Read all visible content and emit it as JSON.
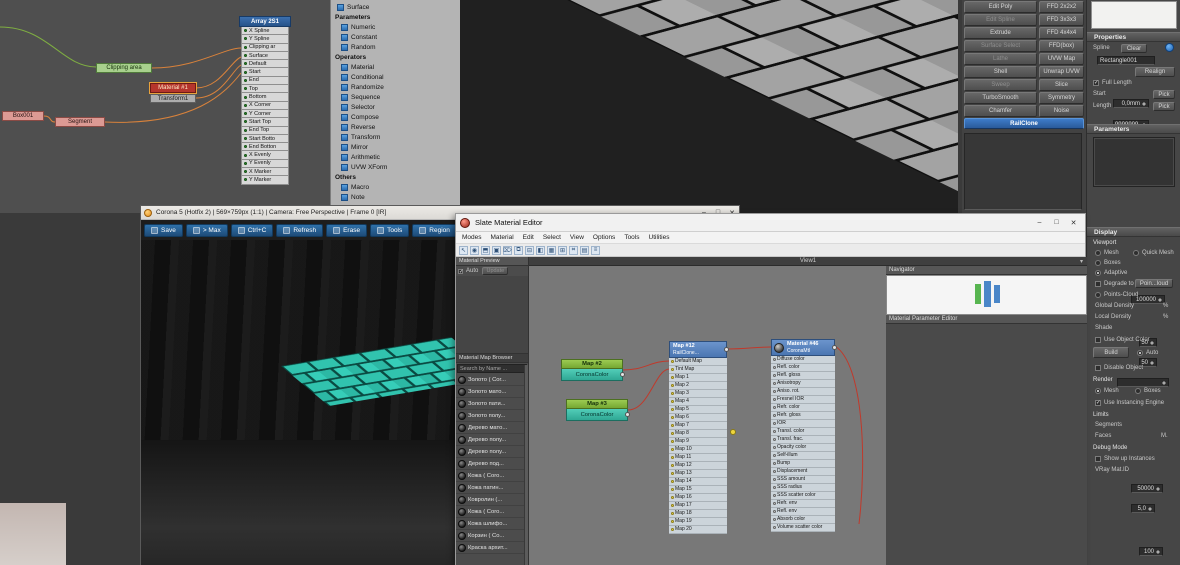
{
  "style_editor": {
    "array_node": {
      "title": "Array 2S1",
      "outputs": [
        "X Spline",
        "Y Spline",
        "Clipping ar",
        "Surface",
        "Default",
        "Start",
        "End",
        "Top",
        "Bottom",
        "X Corner",
        "Y Corner",
        "Start Top",
        "End Top",
        "Start Botto",
        "End Botton",
        "X Evenly",
        "Y Evenly",
        "X Marker",
        "Y Marker"
      ]
    },
    "clipping_node": "Clipping area",
    "material_node": "Material #1",
    "transform_node": "Transform1",
    "box_node": "Box001",
    "segment_node": "Segment",
    "palette": {
      "surface": "Surface",
      "groups": [
        {
          "label": "Parameters",
          "items": [
            "Numeric",
            "Constant",
            "Random"
          ]
        },
        {
          "label": "Operators",
          "items": [
            "Material",
            "Conditional",
            "Randomize",
            "Sequence",
            "Selector",
            "Compose",
            "Reverse",
            "Transform",
            "Mirror",
            "Arithmetic",
            "UVW XForm"
          ]
        },
        {
          "label": "Others",
          "items": [
            "Macro",
            "Note"
          ]
        }
      ]
    }
  },
  "modifier_panel": {
    "rows": [
      {
        "l": "Edit Poly",
        "r": "FFD 2x2x2"
      },
      {
        "l": "Edit Spline",
        "r": "FFD 3x3x3",
        "lcls": "dim"
      },
      {
        "l": "Extrude",
        "r": "FFD 4x4x4"
      },
      {
        "l": "Surface Select",
        "r": "FFD(box)",
        "lcls": "dim"
      },
      {
        "l": "Lathe",
        "r": "UVW Map",
        "lcls": "dim"
      },
      {
        "l": "Shell",
        "r": "Unwrap UVW"
      },
      {
        "l": "Sweep",
        "r": "Slice",
        "lcls": "dim"
      },
      {
        "l": "TurboSmooth",
        "r": "Symmetry"
      },
      {
        "l": "Chamfer",
        "r": "Noise"
      }
    ],
    "railclone": "RailClone"
  },
  "properties": {
    "title": "Properties",
    "spline": "Spline",
    "clear": "Clear",
    "spline_name": "Rectangle001",
    "realign": "Realign",
    "full_length": "Full Length",
    "start": "Start",
    "start_value": "0,0mm",
    "length": "Length",
    "length_value": "9999999,",
    "pick": "Pick",
    "parameters": "Parameters"
  },
  "display": {
    "title": "Display",
    "viewport": "Viewport",
    "mesh": "Mesh",
    "quick_mesh": "Quick Mesh",
    "boxes": "Boxes",
    "adaptive": "Adaptive",
    "adaptive_value": "100000",
    "degrade_to": "Degrade to",
    "degrade_btn": "Poin...loud",
    "points_cloud": "Points-Cloud",
    "global_density": "Global Density",
    "global_value": "50",
    "local_density": "Local Density",
    "local_value": "50",
    "percent": "%",
    "shade": "Shade",
    "use_object_color": "Use Object Color",
    "build": "Build",
    "auto": "Auto",
    "disable_object": "Disable Object",
    "render": "Render",
    "render_mesh": "Mesh",
    "render_boxes": "Boxes",
    "use_instancing": "Use Instancing Engine",
    "limits": "Limits",
    "segments": "Segments",
    "segments_value": "50000",
    "faces": "Faces",
    "faces_value": "5,0",
    "faces_unit": "M.",
    "debug": "Debug Mode",
    "show_instances": "Show up Instances",
    "vray": "VRay Mat.ID",
    "vray_value": "100"
  },
  "corona": {
    "title": "Corona 5 (Hotfix 2) | 569×759px (1:1) | Camera: Free Perspective | Frame 0 [IR]",
    "buttons": [
      "Save",
      "> Max",
      "Ctrl+C",
      "Refresh",
      "Erase",
      "Tools",
      "Region"
    ],
    "window_controls": {
      "min": "–",
      "max": "□",
      "close": "✕"
    }
  },
  "slate": {
    "title": "Slate Material Editor",
    "menus": [
      "Modes",
      "Material",
      "Edit",
      "Select",
      "View",
      "Options",
      "Tools",
      "Utilities"
    ],
    "toolbar_icons": [
      "↖",
      "◉",
      "⬒",
      "▣",
      "⌦",
      "⧉",
      "⊟",
      "◧",
      "▦",
      "⊞",
      "⌗",
      "▤",
      "≡"
    ],
    "preview_header": "Material Preview",
    "auto": "Auto",
    "update": "Update",
    "browser_header": "Material Map Browser",
    "search": "Search by Name ...",
    "materials": [
      "Золото ( Cor...",
      "Золото мато...",
      "Золото пати...",
      "Золото полу...",
      "Дерево мато...",
      "Дерево полу...",
      "Дерево полу...",
      "Дерево под...",
      "Кожа ( Coro...",
      "Кожа патин...",
      "Ковролин (...",
      "Кожа ( Coro...",
      "Кожа шлифо...",
      "Корзин ( Co...",
      "Краска архит..."
    ],
    "view_tab": "View1",
    "view_dropdown": "▾",
    "map2_name": "Map #2",
    "map2_type": "CoronaColor",
    "map3_name": "Map #3",
    "map3_type": "CoronaColor",
    "rc_name": "Map #12",
    "rc_type": "RailClone...",
    "rc_slots": [
      "Default Map",
      "Tint Map",
      "Map 1",
      "Map 2",
      "Map 3",
      "Map 4",
      "Map 5",
      "Map 6",
      "Map 7",
      "Map 8",
      "Map 9",
      "Map 10",
      "Map 11",
      "Map 12",
      "Map 13",
      "Map 14",
      "Map 15",
      "Map 16",
      "Map 17",
      "Map 18",
      "Map 19",
      "Map 20"
    ],
    "mtl_name": "Material #46",
    "mtl_type": "CoronaMtl",
    "mtl_slots": [
      "Diffuse color",
      "Refl. color",
      "Refl. gloss",
      "Anisotropy",
      "Aniso. rot.",
      "Fresnel IOR",
      "Refr. color",
      "Refr. gloss",
      "IOR",
      "Transl. color",
      "Transl. frac.",
      "Opacity color",
      "Self-illum",
      "Bump",
      "Displacement",
      "SSS amount",
      "SSS radius",
      "SSS scatter color",
      "Refr. env",
      "Refl. env",
      "Absorb color",
      "Volume scatter color"
    ],
    "navigator": "Navigator",
    "param_editor": "Material Parameter Editor",
    "window_controls": {
      "min": "–",
      "max": "□",
      "close": "✕"
    }
  }
}
